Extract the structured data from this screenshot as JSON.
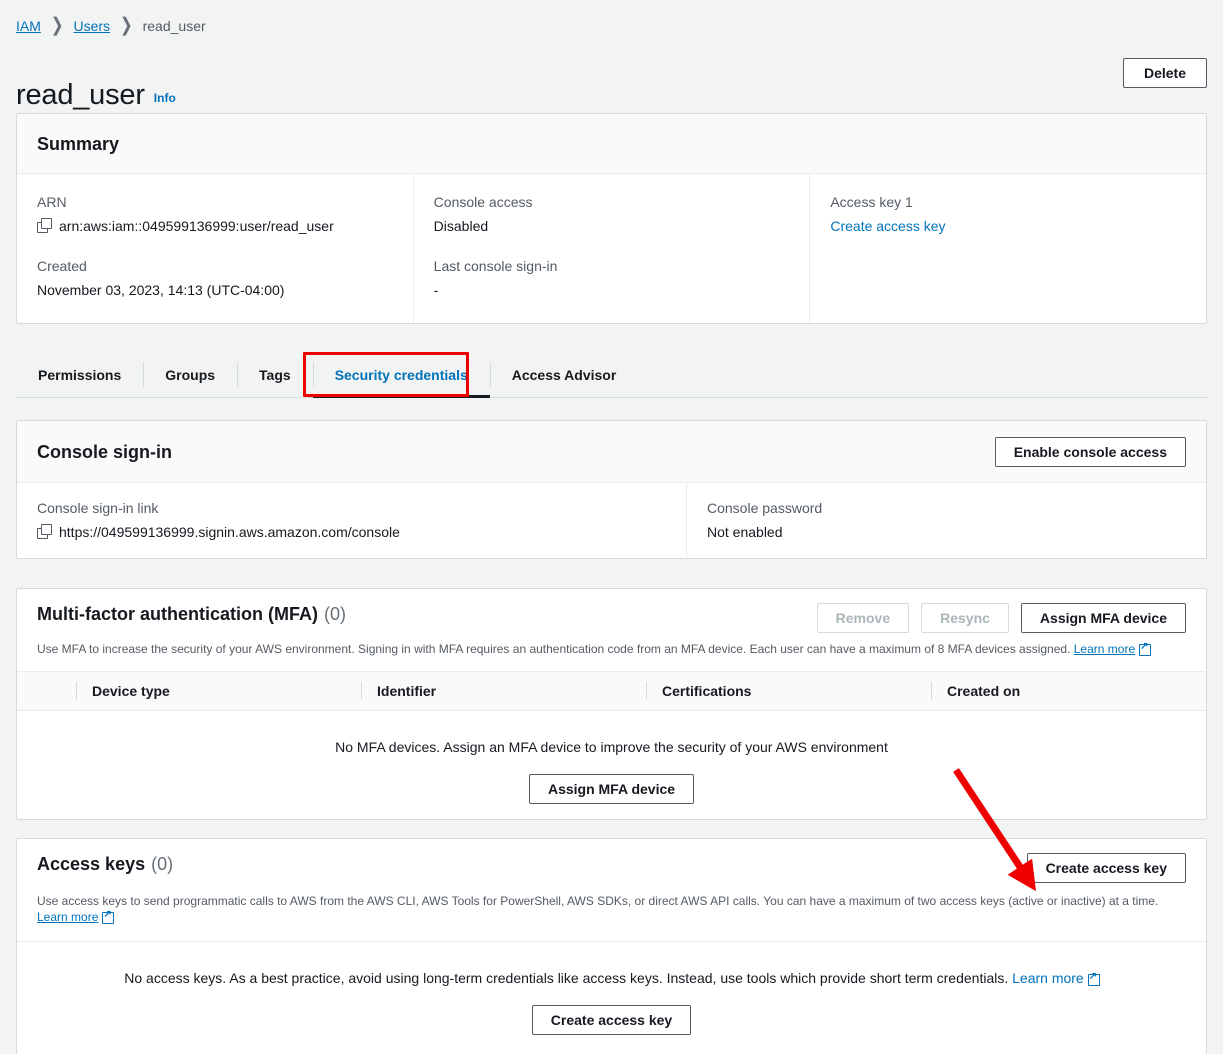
{
  "breadcrumb": {
    "items": [
      {
        "label": "IAM",
        "link": true
      },
      {
        "label": "Users",
        "link": true
      },
      {
        "label": "read_user",
        "link": false
      }
    ],
    "separator": "❯"
  },
  "header": {
    "title": "read_user",
    "info_label": "Info",
    "delete_label": "Delete"
  },
  "summary": {
    "title": "Summary",
    "arn_label": "ARN",
    "arn_value": "arn:aws:iam::049599136999:user/read_user",
    "created_label": "Created",
    "created_value": "November 03, 2023, 14:13 (UTC-04:00)",
    "console_access_label": "Console access",
    "console_access_value": "Disabled",
    "last_signin_label": "Last console sign-in",
    "last_signin_value": "-",
    "access_key_label": "Access key 1",
    "access_key_link": "Create access key"
  },
  "tabs": [
    {
      "label": "Permissions",
      "active": false
    },
    {
      "label": "Groups",
      "active": false
    },
    {
      "label": "Tags",
      "active": false
    },
    {
      "label": "Security credentials",
      "active": true
    },
    {
      "label": "Access Advisor",
      "active": false
    }
  ],
  "console_signin": {
    "title": "Console sign-in",
    "enable_button": "Enable console access",
    "link_label": "Console sign-in link",
    "link_value": "https://049599136999.signin.aws.amazon.com/console",
    "password_label": "Console password",
    "password_value": "Not enabled"
  },
  "mfa": {
    "title": "Multi-factor authentication (MFA)",
    "count": "(0)",
    "remove_label": "Remove",
    "resync_label": "Resync",
    "assign_label": "Assign MFA device",
    "description": "Use MFA to increase the security of your AWS environment. Signing in with MFA requires an authentication code from an MFA device. Each user can have a maximum of 8 MFA devices assigned.",
    "learn_more": "Learn more",
    "columns": [
      "Device type",
      "Identifier",
      "Certifications",
      "Created on"
    ],
    "rows": [],
    "empty_text": "No MFA devices. Assign an MFA device to improve the security of your AWS environment",
    "empty_button": "Assign MFA device"
  },
  "access_keys": {
    "title": "Access keys",
    "count": "(0)",
    "create_label": "Create access key",
    "description": "Use access keys to send programmatic calls to AWS from the AWS CLI, AWS Tools for PowerShell, AWS SDKs, or direct AWS API calls. You can have a maximum of two access keys (active or inactive) at a time.",
    "learn_more": "Learn more",
    "empty_text": "No access keys. As a best practice, avoid using long-term credentials like access keys. Instead, use tools which provide short term credentials.",
    "empty_learn_more": "Learn more",
    "empty_button": "Create access key"
  },
  "annotations": {
    "highlight_color": "#ee0000",
    "arrow_color": "#ee0000"
  },
  "colors": {
    "page_background": "#f2f3f3",
    "card_background": "#ffffff",
    "link": "#0073bb",
    "text": "#16191f",
    "muted_text": "#545b64",
    "border": "#d5dbdb"
  }
}
